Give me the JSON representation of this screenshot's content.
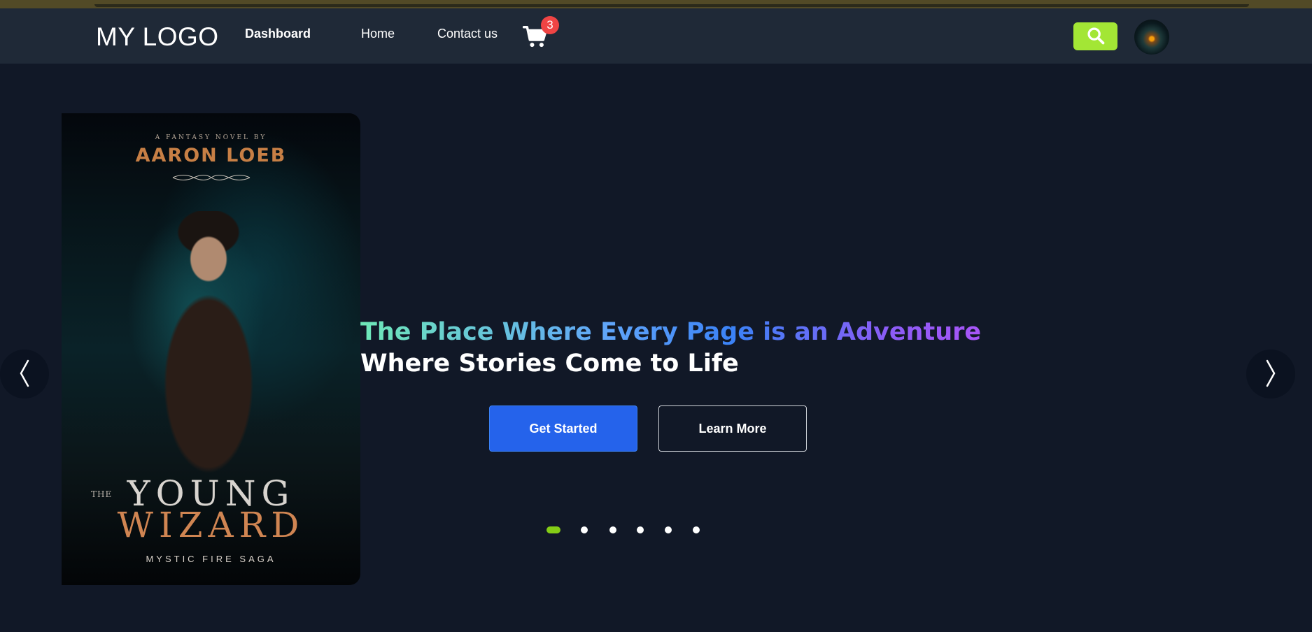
{
  "navbar": {
    "logo": "MY LOGO",
    "links": [
      {
        "label": "Dashboard",
        "active": true
      },
      {
        "label": "Home",
        "active": false
      },
      {
        "label": "Contact us",
        "active": false
      }
    ],
    "cart_count": "3",
    "icons": {
      "cart": "cart-icon",
      "search": "search-icon",
      "avatar": "avatar"
    },
    "colors": {
      "search_bg": "#a3e635",
      "badge_bg": "#ef4444",
      "nav_bg": "#1f2937"
    }
  },
  "hero": {
    "cover": {
      "tagline": "A FANTASY NOVEL BY",
      "author": "AARON LOEB",
      "title_prefix": "THE",
      "title_line1": "YOUNG",
      "title_line2": "WIZARD",
      "series": "MYSTIC FIRE SAGA"
    },
    "headline": "The Place Where Every Page is an Adventure",
    "subheadline": "Where Stories Come to Life",
    "primary_button": "Get Started",
    "secondary_button": "Learn More",
    "arrows": {
      "prev": "chevron-left-icon",
      "next": "chevron-right-icon"
    },
    "slide_count": 6,
    "active_slide": 1,
    "colors": {
      "primary": "#2563eb",
      "active_dot": "#84cc16",
      "page_bg": "#111827"
    }
  }
}
